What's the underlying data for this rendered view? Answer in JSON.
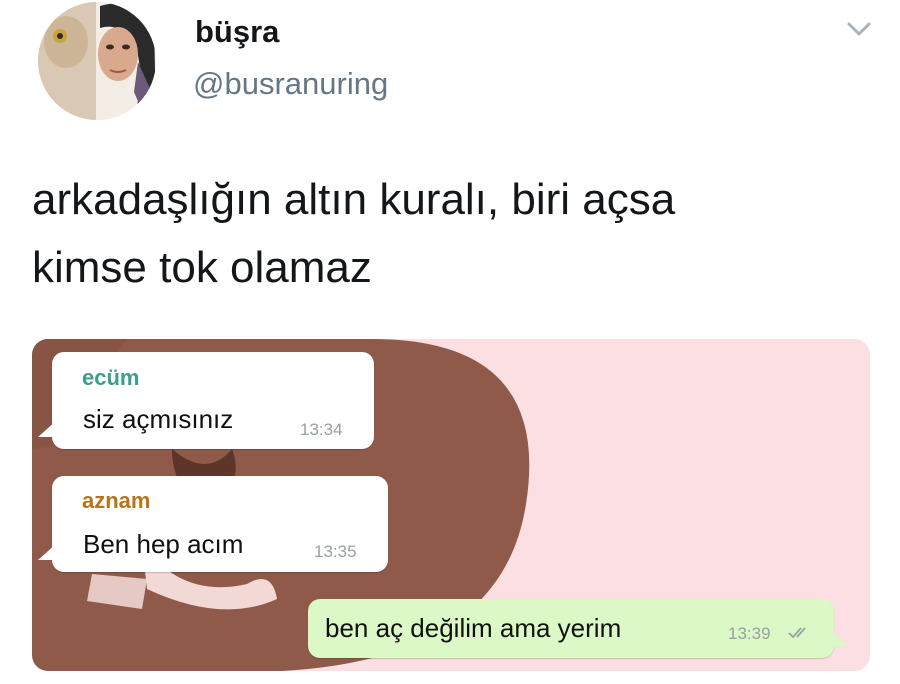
{
  "author": {
    "display_name": "büşra",
    "handle": "@busranuring"
  },
  "tweet": {
    "line1": "arkadaşlığın altın kuralı, biri açsa",
    "line2": "kimse tok olamaz"
  },
  "icons": {
    "menu": "chevron-down-icon",
    "read": "double-check-icon"
  },
  "chat": {
    "messages": [
      {
        "direction": "incoming",
        "sender": "ecüm",
        "text": "siz açmısınız",
        "time": "13:34"
      },
      {
        "direction": "incoming",
        "sender": "aznam",
        "text": "Ben hep acım",
        "time": "13:35"
      },
      {
        "direction": "outgoing",
        "text": "ben aç değilim ama yerim",
        "time": "13:39"
      }
    ]
  },
  "colors": {
    "background_brown": "#8f5a4a",
    "background_pink": "#fbdfe2",
    "sender_ecum": "#3aa08c",
    "sender_aznam": "#b8741a",
    "outgoing_bubble": "#dcf8c6"
  }
}
